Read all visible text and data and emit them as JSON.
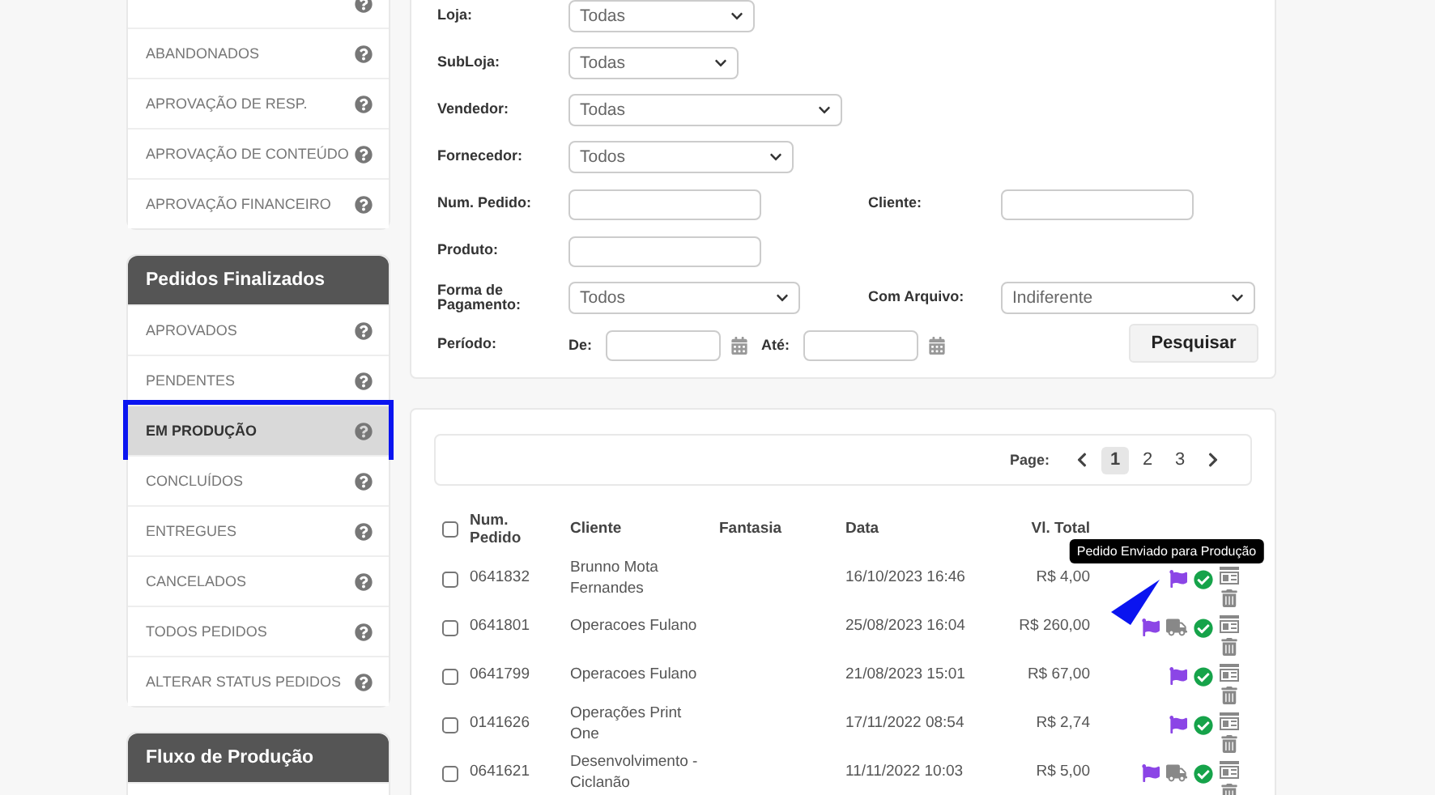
{
  "sidebar": {
    "groups": [
      {
        "items": [
          {
            "selected": false,
            "annotated": false
          },
          {
            "label": "ABANDONADOS",
            "selected": false,
            "annotated": false
          },
          {
            "label": "APROVAÇÃO DE RESP.",
            "selected": false,
            "annotated": false
          },
          {
            "label": "APROVAÇÃO DE CONTEÚDO",
            "selected": false,
            "annotated": false
          },
          {
            "label": "APROVAÇÃO FINANCEIRO",
            "selected": false,
            "annotated": false
          }
        ]
      },
      {
        "title": "Pedidos Finalizados",
        "items": [
          {
            "label": "APROVADOS",
            "selected": false,
            "annotated": false
          },
          {
            "label": "PENDENTES",
            "selected": false,
            "annotated": false
          },
          {
            "label": "EM PRODUÇÃO",
            "selected": true,
            "annotated": true
          },
          {
            "label": "CONCLUÍDOS",
            "selected": false,
            "annotated": false
          },
          {
            "label": "ENTREGUES",
            "selected": false,
            "annotated": false
          },
          {
            "label": "CANCELADOS",
            "selected": false,
            "annotated": false
          },
          {
            "label": "TODOS PEDIDOS",
            "selected": false,
            "annotated": false
          },
          {
            "label": "ALTERAR STATUS PEDIDOS",
            "selected": false,
            "annotated": false
          }
        ]
      },
      {
        "title": "Fluxo de Produção"
      }
    ]
  },
  "filters": {
    "rows": [
      {
        "fields": [
          {
            "kind": "select",
            "label": "Loja:",
            "value": "Todas"
          }
        ]
      },
      {
        "fields": [
          {
            "kind": "select",
            "label": "SubLoja:",
            "value": "Todas"
          }
        ]
      },
      {
        "fields": [
          {
            "kind": "select",
            "label": "Vendedor:",
            "value": "Todas"
          }
        ]
      },
      {
        "fields": [
          {
            "kind": "select",
            "label": "Fornecedor:",
            "value": "Todos"
          }
        ]
      },
      {
        "fields": [
          {
            "kind": "input",
            "label": "Num. Pedido:"
          },
          {
            "kind": "input",
            "label": "Cliente:"
          }
        ]
      },
      {
        "fields": [
          {
            "kind": "input",
            "label": "Produto:"
          }
        ]
      },
      {
        "fields": [
          {
            "kind": "select",
            "label": "Forma de Pagamento:",
            "value": "Todos"
          },
          {
            "kind": "select",
            "label": "Com Arquivo:",
            "value": "Indiferente"
          }
        ]
      },
      {
        "fields": [
          {
            "kind": "period",
            "label": "Período:",
            "from_label": "De:",
            "to_label": "Até:"
          }
        ]
      }
    ],
    "search_button": "Pesquisar"
  },
  "pagination": {
    "label": "Page:",
    "pages": [
      {
        "label": "1",
        "selected": true
      },
      {
        "label": "2",
        "selected": false
      },
      {
        "label": "3",
        "selected": false
      }
    ]
  },
  "table": {
    "select_all_checked": false,
    "columns": [
      "Num. Pedido",
      "Cliente",
      "Fantasia",
      "Data",
      "Vl. Total"
    ],
    "rows": [
      {
        "checked": false,
        "number": "0641832",
        "client": "Brunno Mota Fernandes",
        "date": "16/10/2023 16:46",
        "total": "R$ 4,00",
        "truck": false,
        "tooltip": "Pedido Enviado para Produção",
        "annotated": true
      },
      {
        "checked": false,
        "number": "0641801",
        "client": "Operacoes Fulano",
        "date": "25/08/2023 16:04",
        "total": "R$ 260,00",
        "truck": true,
        "annotated": false
      },
      {
        "checked": false,
        "number": "0641799",
        "client": "Operacoes Fulano",
        "date": "21/08/2023 15:01",
        "total": "R$ 67,00",
        "truck": false,
        "annotated": false
      },
      {
        "checked": false,
        "number": "0141626",
        "client": "Operações Print One",
        "date": "17/11/2022 08:54",
        "total": "R$ 2,74",
        "truck": false,
        "annotated": false
      },
      {
        "checked": false,
        "number": "0641621",
        "client": "Desenvolvimento - Ciclanão",
        "date": "11/11/2022 10:03",
        "total": "R$ 5,00",
        "truck": true,
        "annotated": false
      }
    ]
  }
}
